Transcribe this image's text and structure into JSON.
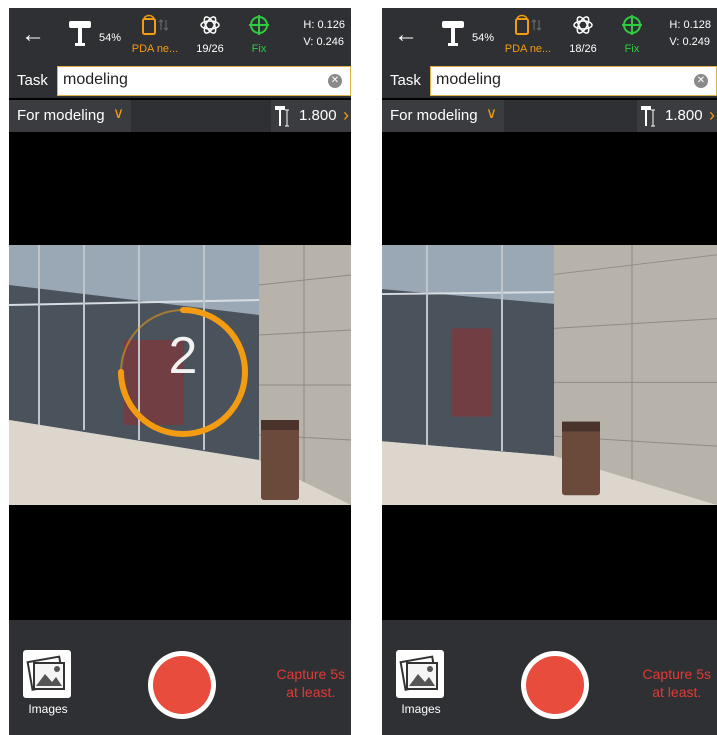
{
  "screens": [
    {
      "status": {
        "battery": "54%",
        "pda_label": "PDA ne...",
        "satellites": "19/26",
        "fix_label": "Fix",
        "h": "H: 0.126",
        "v": "V: 0.246"
      },
      "task": {
        "label": "Task",
        "value": "modeling"
      },
      "mode": {
        "label": "For modeling",
        "rod_height": "1.800"
      },
      "countdown": "2",
      "bottom": {
        "images_label": "Images",
        "hint_line1": "Capture 5s",
        "hint_line2": "at least."
      }
    },
    {
      "status": {
        "battery": "54%",
        "pda_label": "PDA ne...",
        "satellites": "18/26",
        "fix_label": "Fix",
        "h": "H: 0.128",
        "v": "V: 0.249"
      },
      "task": {
        "label": "Task",
        "value": "modeling"
      },
      "mode": {
        "label": "For modeling",
        "rod_height": "1.800"
      },
      "bottom": {
        "images_label": "Images",
        "hint_line1": "Capture 5s",
        "hint_line2": "at least."
      }
    }
  ],
  "icons": [
    "back-arrow-icon",
    "antenna-icon",
    "pda-network-icon",
    "satellite-icon",
    "fix-crosshair-icon",
    "clear-icon",
    "chevron-down-icon",
    "range-pole-icon",
    "chevron-right-icon",
    "gallery-icon",
    "shutter-icon"
  ],
  "colors": {
    "bar": "#2e3033",
    "accent": "#f39c12",
    "fix": "#2ecc40",
    "record": "#e74c3c",
    "hint": "#e53935"
  },
  "countdown_progress": 0.75
}
